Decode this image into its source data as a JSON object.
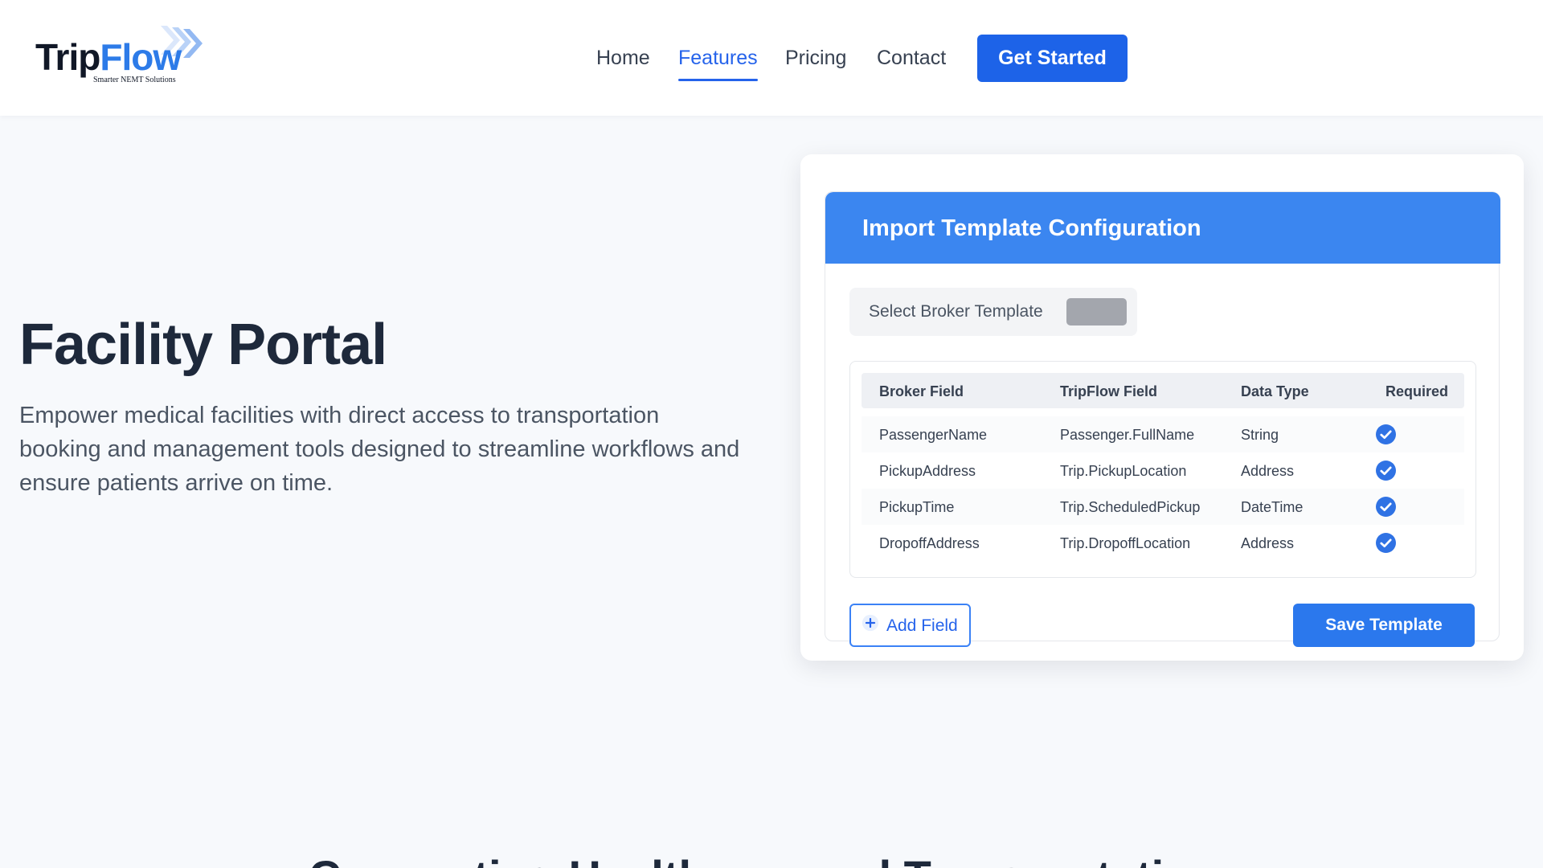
{
  "brand": {
    "name_part1": "Trip",
    "name_part2": "Flow",
    "tagline": "Smarter NEMT Solutions",
    "dark_color": "#111827",
    "accent_color": "#2d7be8"
  },
  "nav": {
    "items": [
      {
        "label": "Home",
        "active": false
      },
      {
        "label": "Features",
        "active": true
      },
      {
        "label": "Pricing",
        "active": false
      },
      {
        "label": "Contact",
        "active": false
      }
    ],
    "cta_label": "Get Started"
  },
  "hero": {
    "title": "Facility Portal",
    "description": "Empower medical facilities with direct access to transportation booking and management tools designed to streamline workflows and ensure patients arrive on time."
  },
  "template_card": {
    "title": "Import Template Configuration",
    "select_label": "Select Broker Template",
    "columns": [
      "Broker Field",
      "TripFlow Field",
      "Data Type",
      "Required"
    ],
    "rows": [
      {
        "broker_field": "PassengerName",
        "tripflow_field": "Passenger.FullName",
        "data_type": "String",
        "required": true
      },
      {
        "broker_field": "PickupAddress",
        "tripflow_field": "Trip.PickupLocation",
        "data_type": "Address",
        "required": true
      },
      {
        "broker_field": "PickupTime",
        "tripflow_field": "Trip.ScheduledPickup",
        "data_type": "DateTime",
        "required": true
      },
      {
        "broker_field": "DropoffAddress",
        "tripflow_field": "Trip.DropoffLocation",
        "data_type": "Address",
        "required": true
      }
    ],
    "add_field_label": "Add Field",
    "save_label": "Save Template",
    "header_color": "#3b86f0",
    "check_color": "#2f72e4"
  },
  "section": {
    "title": "Connecting Healthcare and Transportation"
  },
  "icons": {
    "logo_chevrons": "chevron-right-double-icon",
    "required_check": "check-circle-icon",
    "add": "plus-icon"
  }
}
